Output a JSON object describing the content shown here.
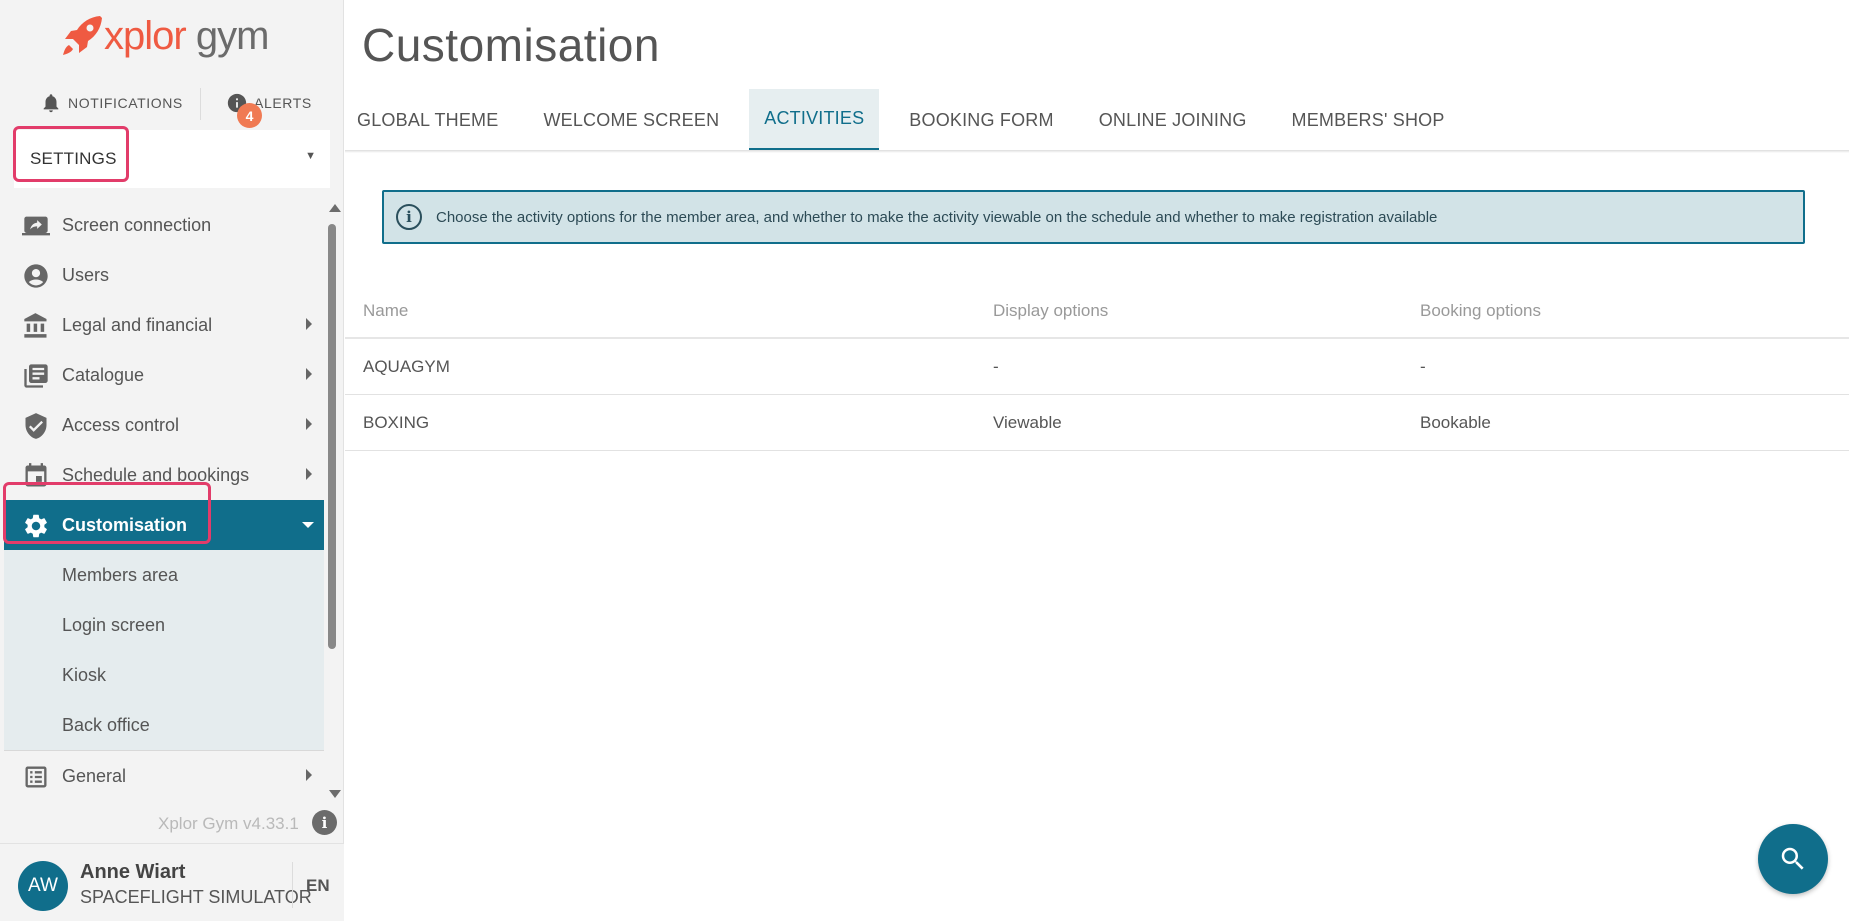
{
  "brand": {
    "name_part1": "xplor",
    "name_part2": " gym",
    "color": "#ef5a42"
  },
  "topbar": {
    "notifications_label": "NOTIFICATIONS",
    "alerts_label": "ALERTS",
    "alerts_count": "4"
  },
  "settings_dropdown": {
    "label": "SETTINGS"
  },
  "sidebar": {
    "items": [
      {
        "label": "Screen connection",
        "icon": "screen-share-icon"
      },
      {
        "label": "Users",
        "icon": "account-circle-icon"
      },
      {
        "label": "Legal and financial",
        "icon": "bank-icon"
      },
      {
        "label": "Catalogue",
        "icon": "library-books-icon"
      },
      {
        "label": "Access control",
        "icon": "shield-check-icon"
      },
      {
        "label": "Schedule and bookings",
        "icon": "calendar-icon"
      },
      {
        "label": "Customisation",
        "icon": "gear-icon"
      }
    ],
    "subitems": [
      "Members area",
      "Login screen",
      "Kiosk",
      "Back office"
    ],
    "after_items": [
      {
        "label": "General",
        "icon": "list-icon"
      }
    ],
    "active_color": "#106e8b"
  },
  "version": "Xplor Gym v4.33.1",
  "user": {
    "initials": "AW",
    "name": "Anne Wiart",
    "org": "SPACEFLIGHT SIMULATOR",
    "lang": "EN"
  },
  "main": {
    "title": "Customisation",
    "tabs": [
      "GLOBAL THEME",
      "WELCOME SCREEN",
      "ACTIVITIES",
      "BOOKING FORM",
      "ONLINE JOINING",
      "MEMBERS' SHOP"
    ],
    "active_tab": "ACTIVITIES",
    "info_banner": "Choose the activity options for the member area, and whether to make the activity viewable on the schedule and whether to make registration available",
    "table": {
      "headers": [
        "Name",
        "Display options",
        "Booking options"
      ],
      "rows": [
        [
          "AQUAGYM",
          "-",
          "-"
        ],
        [
          "BOXING",
          "Viewable",
          "Bookable"
        ]
      ]
    }
  }
}
